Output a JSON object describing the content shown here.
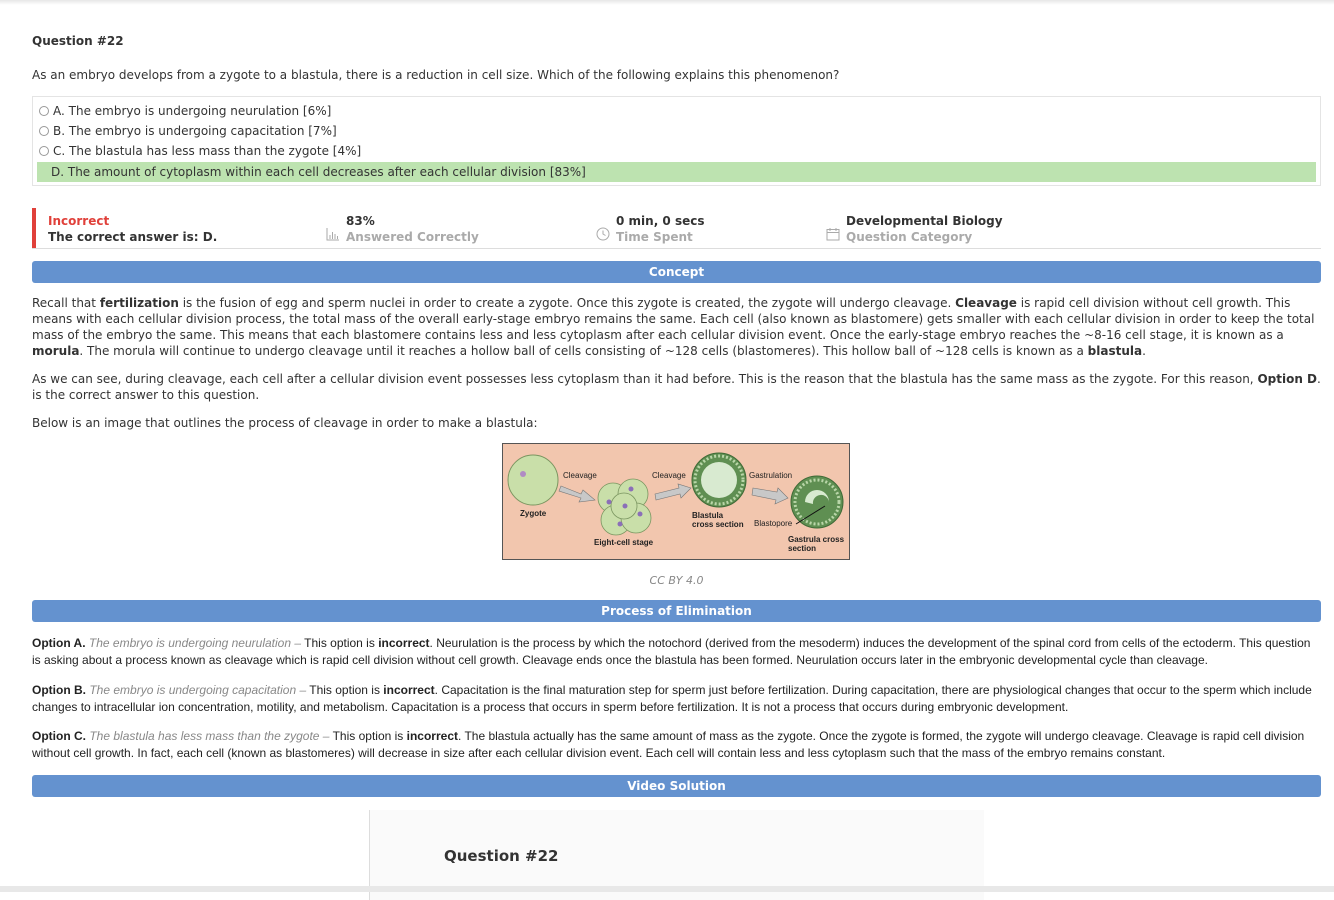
{
  "question": {
    "number": "Question #22",
    "text": "As an embryo develops from a zygote to a blastula, there is a reduction in cell size. Which of the following explains this phenomenon?",
    "choices": [
      {
        "label": "A. The embryo is undergoing neurulation [6%]",
        "correct": false
      },
      {
        "label": "B. The embryo is undergoing capacitation [7%]",
        "correct": false
      },
      {
        "label": "C. The blastula has less mass than the zygote [4%]",
        "correct": false
      },
      {
        "label": "D. The amount of cytoplasm within each cell decreases after each cellular division [83%]",
        "correct": true
      }
    ]
  },
  "result": {
    "status": "Incorrect",
    "answer_text": "The correct answer is: D.",
    "answered_correctly_value": "83%",
    "answered_correctly_label": "Answered Correctly",
    "time_value": "0 min, 0 secs",
    "time_label": "Time Spent",
    "category_value": "Developmental Biology",
    "category_label": "Question Category"
  },
  "concept": {
    "heading": "Concept",
    "p1_parts": [
      "Recall that ",
      "fertilization",
      " is the fusion of egg and sperm nuclei in order to create a zygote. Once this zygote is created, the zygote will undergo cleavage. ",
      "Cleavage",
      " is rapid cell division without cell growth. This means with each cellular division process, the total mass of the overall early-stage embryo remains the same. Each cell (also known as blastomere) gets smaller with each cellular division in order to keep the total mass of the embryo the same. This means that each blastomere contains less and less cytoplasm after each cellular division event. Once the early-stage embryo reaches the ~8-16 cell stage, it is known as a ",
      "morula",
      ". The morula will continue to undergo cleavage until it reaches a hollow ball of cells consisting of ~128 cells (blastomeres). This hollow ball of ~128 cells is known as a ",
      "blastula",
      "."
    ],
    "p2_parts": [
      "As we can see, during cleavage, each cell after a cellular division event possesses less cytoplasm than it had before. This is the reason that the blastula has the same mass as the zygote. For this reason, ",
      "Option D",
      ". is the correct answer to this question."
    ],
    "p3": "Below is an image that outlines the process of cleavage in order to make a blastula:",
    "figure": {
      "labels": {
        "zygote": "Zygote",
        "cleavage1": "Cleavage",
        "cleavage2": "Cleavage",
        "gastrulation": "Gastrulation",
        "eight_cell": "Eight-cell stage",
        "blastula1": "Blastula",
        "blastula2": "cross section",
        "blastopore": "Blastopore",
        "gastrula1": "Gastrula cross",
        "gastrula2": "section"
      },
      "colors": {
        "background": "#f2c6ae",
        "cell": "#c9dfa9",
        "blastula": "#8fb57a",
        "arrow": "#c8c8c8"
      }
    },
    "caption": "CC BY 4.0"
  },
  "elimination": {
    "heading": "Process of Elimination",
    "options": [
      {
        "prefix": "Option A.",
        "quote": "The embryo is undergoing neurulation –",
        "pre": " This option is ",
        "bold": "incorrect",
        "rest": ". Neurulation is the process by which the notochord (derived from the mesoderm) induces the development of the spinal cord from cells of the ectoderm. This question is asking about a process known as cleavage which is rapid cell division without cell growth. Cleavage ends once the blastula has been formed. Neurulation occurs later in the embryonic developmental cycle than cleavage."
      },
      {
        "prefix": "Option B.",
        "quote": "The embryo is undergoing capacitation –",
        "pre": " This option is ",
        "bold": "incorrect",
        "rest": ". Capacitation is the final maturation step for sperm just before fertilization. During capacitation, there are physiological changes that occur to the sperm which include changes to intracellular ion concentration, motility, and metabolism. Capacitation is a process that occurs in sperm before fertilization. It is not a process that occurs during embryonic development."
      },
      {
        "prefix": "Option C.",
        "quote": "The blastula has less mass than the zygote –",
        "pre": " This option is ",
        "bold": "incorrect",
        "rest": ". The blastula actually has the same amount of mass as the zygote. Once the zygote is formed, the zygote will undergo cleavage. Cleavage is rapid cell division without cell growth. In fact, each cell (known as blastomeres) will decrease in size after each cellular division event. Each cell will contain less and less cytoplasm such that the mass of the embryo remains constant."
      }
    ]
  },
  "video": {
    "heading": "Video Solution",
    "title": "Question #22"
  },
  "colors": {
    "accent": "#6492cf",
    "correct": "#bde3b0",
    "incorrect": "#e0403a"
  }
}
